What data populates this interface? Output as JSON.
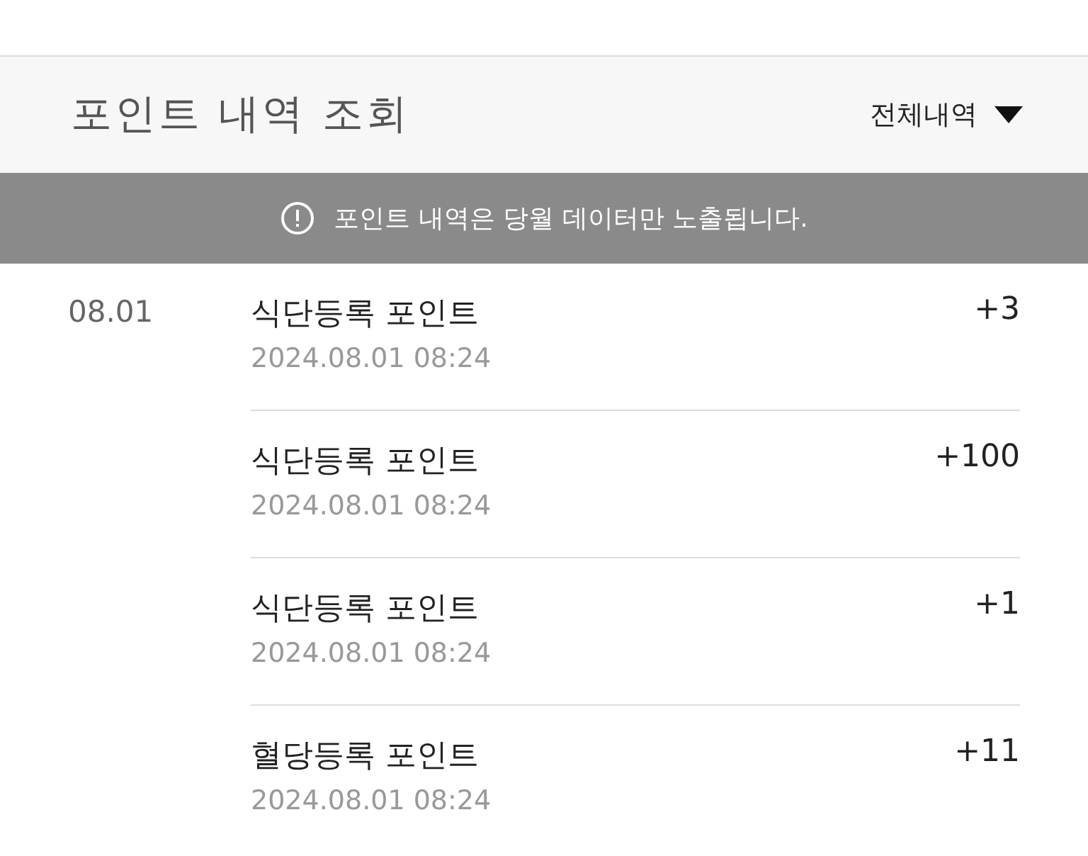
{
  "header": {
    "title": "포인트 내역 조회",
    "filter": {
      "label": "전체내역"
    }
  },
  "notice": {
    "text": "포인트 내역은 당월 데이터만 노출됩니다."
  },
  "groups": [
    {
      "date": "08.01",
      "entries": [
        {
          "title": "식단등록 포인트",
          "time": "2024.08.01 08:24",
          "points": "+3"
        },
        {
          "title": "식단등록 포인트",
          "time": "2024.08.01 08:24",
          "points": "+100"
        },
        {
          "title": "식단등록 포인트",
          "time": "2024.08.01 08:24",
          "points": "+1"
        },
        {
          "title": "혈당등록 포인트",
          "time": "2024.08.01 08:24",
          "points": "+11"
        }
      ]
    }
  ]
}
